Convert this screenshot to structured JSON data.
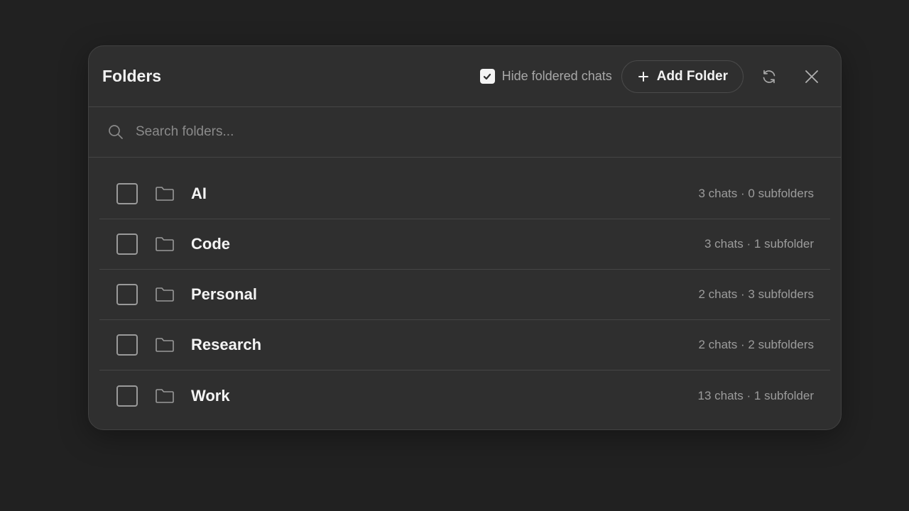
{
  "dialog": {
    "title": "Folders",
    "hide_foldered_label": "Hide foldered chats",
    "hide_foldered_checked": true,
    "add_folder_label": "Add Folder"
  },
  "search": {
    "placeholder": "Search folders...",
    "value": ""
  },
  "icons": {
    "search": "search-icon",
    "refresh": "refresh-icon",
    "close": "close-icon",
    "folder": "folder-icon",
    "plus": "plus-icon",
    "check": "check-icon"
  },
  "colors": {
    "background": "#212121",
    "panel": "#2f2f2f",
    "border": "#454545",
    "text": "#ececec",
    "muted": "#9c9c9c"
  },
  "folders": [
    {
      "name": "AI",
      "meta": "3 chats · 0 subfolders",
      "checked": false
    },
    {
      "name": "Code",
      "meta": "3 chats · 1 subfolder",
      "checked": false
    },
    {
      "name": "Personal",
      "meta": "2 chats · 3 subfolders",
      "checked": false
    },
    {
      "name": "Research",
      "meta": "2 chats · 2 subfolders",
      "checked": false
    },
    {
      "name": "Work",
      "meta": "13 chats · 1 subfolder",
      "checked": false
    }
  ]
}
